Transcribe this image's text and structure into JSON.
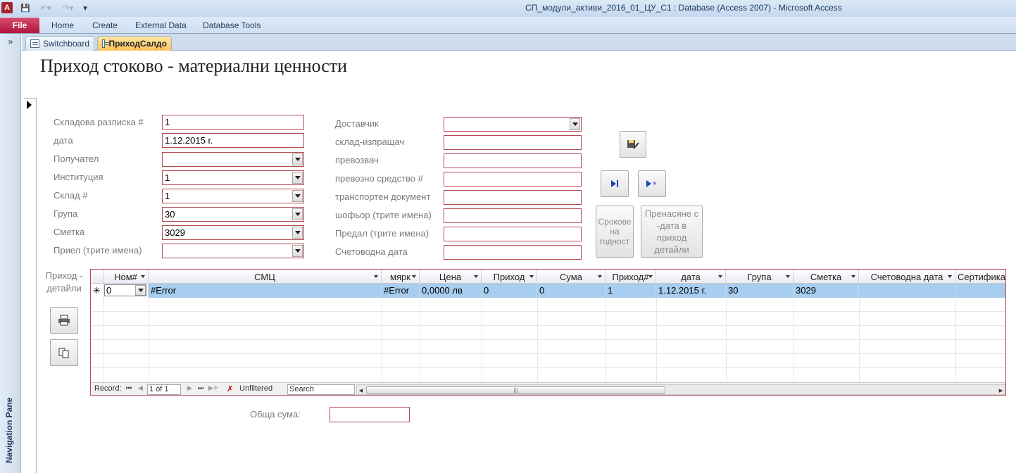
{
  "window": {
    "title": "СП_модули_активи_2016_01_ЦУ_С1 : Database (Access 2007)  -  Microsoft Access",
    "app_icon": "A",
    "save_icon": "💾",
    "undo_icon": "↶▾",
    "redo_icon": "↷▾",
    "qat_menu_icon": "▾"
  },
  "ribbon": {
    "file": "File",
    "tabs": [
      "Home",
      "Create",
      "External Data",
      "Database Tools"
    ]
  },
  "nav_pane": {
    "expand": "»",
    "label": "Navigation Pane"
  },
  "doc_tabs": {
    "switchboard": "Switchboard",
    "active": "ПриходСалдо"
  },
  "form": {
    "title": "Приход стоково - материални ценности",
    "left_fields": [
      {
        "label": "Складова разписка #",
        "value": "1",
        "type": "text"
      },
      {
        "label": "дата",
        "value": "1.12.2015 г.",
        "type": "text"
      },
      {
        "label": "Получател",
        "value": "",
        "type": "combo"
      },
      {
        "label": "Институция",
        "value": "1",
        "type": "combo"
      },
      {
        "label": "Склад #",
        "value": "1",
        "type": "combo"
      },
      {
        "label": "Група",
        "value": "30",
        "type": "combo"
      },
      {
        "label": "Сметка",
        "value": "3029",
        "type": "combo"
      },
      {
        "label": "Приел (трите имена)",
        "value": "",
        "type": "combo"
      }
    ],
    "right_fields": [
      {
        "label": "Доставчик",
        "value": "",
        "type": "combo"
      },
      {
        "label": "склад-изпращач",
        "value": "",
        "type": "text"
      },
      {
        "label": "превозвач",
        "value": "",
        "type": "text"
      },
      {
        "label": "превозно средство #",
        "value": "",
        "type": "text"
      },
      {
        "label": "транспортен документ",
        "value": "",
        "type": "text"
      },
      {
        "label": "шофьор (трите имена)",
        "value": "",
        "type": "text"
      },
      {
        "label": "Предал (трите имена)",
        "value": "",
        "type": "text"
      },
      {
        "label": "Счетоводна дата",
        "value": "",
        "type": "text"
      }
    ],
    "buttons": {
      "expiry": "Срокове на годност",
      "transfer": "Пренасяне с -дата в приход детайли"
    },
    "subform_label": "Приход - детайли",
    "total_label": "Обща сума:"
  },
  "grid": {
    "columns": [
      "Ном#",
      "СМЦ",
      "мярк",
      "Цена",
      "Приход",
      "Сума",
      "Приход#",
      "дата",
      "Група",
      "Сметка",
      "Счетоводна дата",
      "Сертифика"
    ],
    "row": [
      "0",
      "#Error",
      "#Error",
      "0,0000 лв",
      "0",
      "0",
      "1",
      "1.12.2015 г.",
      "30",
      "3029",
      "",
      ""
    ],
    "new_row_marker": "✳"
  },
  "record_nav": {
    "record_label": "Record:",
    "position": "1 of 1",
    "filter": "Unfiltered",
    "search_placeholder": "Search",
    "first": "⏮",
    "prev": "◀",
    "next": "▶",
    "last": "⏭",
    "new": "▶✳"
  }
}
